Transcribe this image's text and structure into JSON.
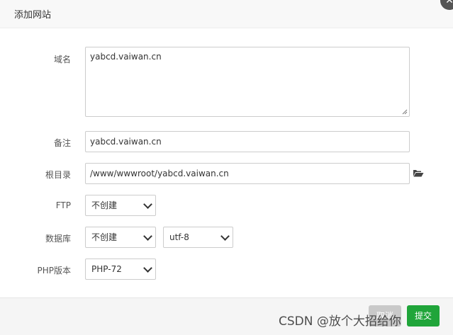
{
  "dialog": {
    "title": "添加网站",
    "close_icon": "close-icon"
  },
  "form": {
    "domain": {
      "label": "域名",
      "value": "yabcd.vaiwan.cn"
    },
    "note": {
      "label": "备注",
      "value": "yabcd.vaiwan.cn"
    },
    "root": {
      "label": "根目录",
      "value": "/www/wwwroot/yabcd.vaiwan.cn",
      "icon": "folder-open-icon"
    },
    "ftp": {
      "label": "FTP",
      "selected": "不创建"
    },
    "database": {
      "label": "数据库",
      "selected": "不创建",
      "charset": "utf-8"
    },
    "php": {
      "label": "PHP版本",
      "selected": "PHP-72"
    }
  },
  "footer": {
    "cancel_label": "取消",
    "submit_label": "提交"
  },
  "watermark": "CSDN @放个大招给你",
  "colors": {
    "submit": "#20a53a",
    "cancel": "#c9c9c9",
    "header_bg": "#f8f8f8"
  }
}
